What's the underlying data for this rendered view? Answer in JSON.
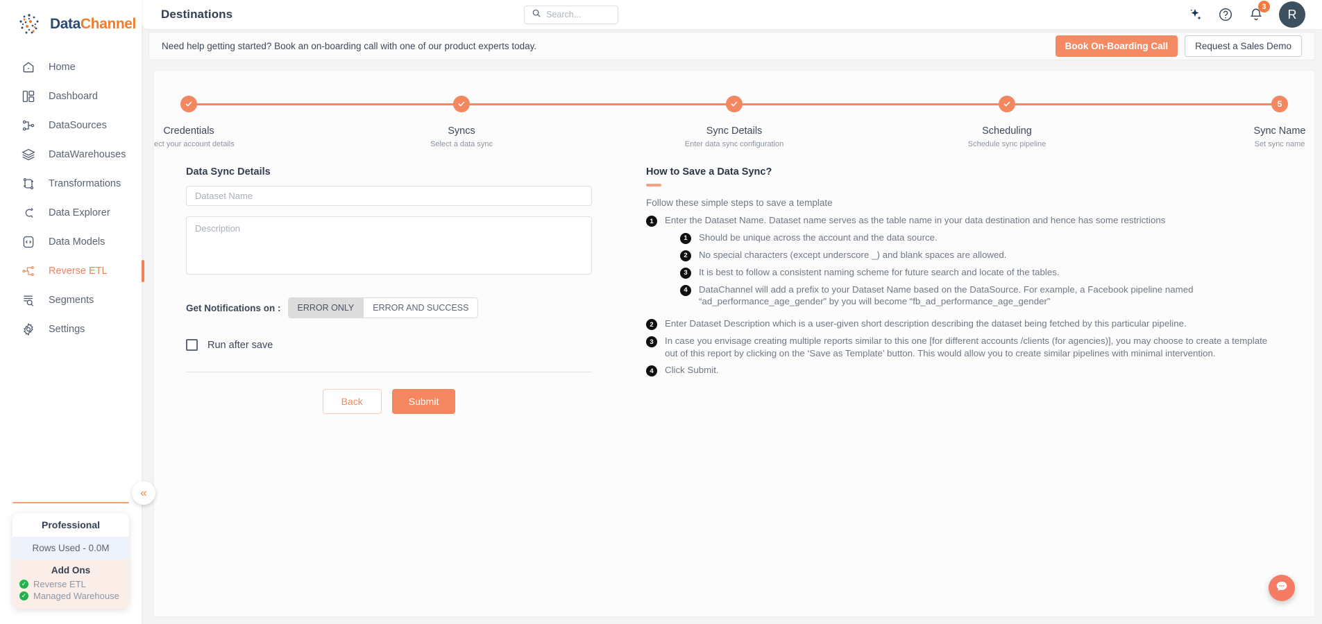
{
  "brand": {
    "name_part1": "Data",
    "name_part2": "Channel",
    "accent": "#f3875f",
    "navy": "#2d4a72"
  },
  "sidebar": {
    "items": [
      {
        "label": "Home",
        "icon": "home-icon",
        "active": false
      },
      {
        "label": "Dashboard",
        "icon": "dashboard-icon",
        "active": false
      },
      {
        "label": "DataSources",
        "icon": "datasources-icon",
        "active": false
      },
      {
        "label": "DataWarehouses",
        "icon": "datawarehouses-icon",
        "active": false
      },
      {
        "label": "Transformations",
        "icon": "transformations-icon",
        "active": false
      },
      {
        "label": "Data Explorer",
        "icon": "data-explorer-icon",
        "active": false
      },
      {
        "label": "Data Models",
        "icon": "data-models-icon",
        "active": false
      },
      {
        "label": "Reverse ETL",
        "icon": "reverse-etl-icon",
        "active": true
      },
      {
        "label": "Segments",
        "icon": "segments-icon",
        "active": false
      },
      {
        "label": "Settings",
        "icon": "settings-icon",
        "active": false
      }
    ],
    "plan": {
      "title": "Professional",
      "rows_used": "Rows Used - 0.0M",
      "addons_header": "Add Ons",
      "addons": [
        "Reverse ETL",
        "Managed Warehouse"
      ]
    },
    "collapse_icon": "«"
  },
  "topbar": {
    "title": "Destinations",
    "search_placeholder": "Search...",
    "notification_count": "3",
    "avatar_initial": "R"
  },
  "banner": {
    "text": "Need help getting started? Book an on-boarding call with one of our product experts today.",
    "primary_button": "Book On-Boarding Call",
    "secondary_button": "Request a Sales Demo"
  },
  "stepper": {
    "steps": [
      {
        "label": "Credentials",
        "sub": "Select your account details",
        "state": "done",
        "marker": "✓"
      },
      {
        "label": "Syncs",
        "sub": "Select a data sync",
        "state": "done",
        "marker": "✓"
      },
      {
        "label": "Sync Details",
        "sub": "Enter data sync configuration",
        "state": "done",
        "marker": "✓"
      },
      {
        "label": "Scheduling",
        "sub": "Schedule sync pipeline",
        "state": "done",
        "marker": "✓"
      },
      {
        "label": "Sync Name",
        "sub": "Set sync name",
        "state": "current",
        "marker": "5"
      }
    ]
  },
  "form": {
    "section_title": "Data Sync Details",
    "dataset_name": {
      "placeholder": "Dataset Name",
      "value": ""
    },
    "description": {
      "placeholder": "Description",
      "value": ""
    },
    "notifications_label": "Get Notifications on :",
    "notification_options": [
      {
        "label": "ERROR ONLY",
        "selected": true
      },
      {
        "label": "ERROR AND SUCCESS",
        "selected": false
      }
    ],
    "run_after_save": {
      "label": "Run after save",
      "checked": false
    },
    "back_button": "Back",
    "submit_button": "Submit"
  },
  "help": {
    "title": "How to Save a Data Sync?",
    "intro": "Follow these simple steps to save a template",
    "items": [
      {
        "num": "1",
        "text": "Enter the Dataset Name. Dataset name serves as the table name in your data destination and hence has some restrictions",
        "sub": [
          {
            "num": "1",
            "text": "Should be unique across the account and the data source."
          },
          {
            "num": "2",
            "text": "No special characters (except underscore _) and blank spaces are allowed."
          },
          {
            "num": "3",
            "text": "It is best to follow a consistent naming scheme for future search and locate of the tables."
          },
          {
            "num": "4",
            "text": "DataChannel will add a prefix to your Dataset Name based on the DataSource. For example, a Facebook pipeline named “ad_performance_age_gender” by you will become “fb_ad_performance_age_gender”"
          }
        ]
      },
      {
        "num": "2",
        "text": "Enter Dataset Description which is a user-given short description describing the dataset being fetched by this particular pipeline.",
        "sub": []
      },
      {
        "num": "3",
        "text": "In case you envisage creating multiple reports similar to this one [for different accounts /clients (for agencies)], you may choose to create a template out of this report by clicking on the ‘Save as Template’ button. This would allow you to create similar pipelines with minimal intervention.",
        "sub": []
      },
      {
        "num": "4",
        "text": "Click Submit.",
        "sub": []
      }
    ]
  },
  "chat": {
    "icon": "chat-bubble-icon"
  }
}
